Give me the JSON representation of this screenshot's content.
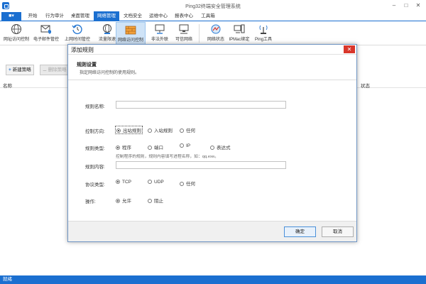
{
  "window": {
    "title": "Ping32终端安全管理系统"
  },
  "menubar": {
    "tabs": [
      {
        "label": "开始",
        "active": false
      },
      {
        "label": "行为审计",
        "active": false
      },
      {
        "label": "桌面管理",
        "active": false
      },
      {
        "label": "网络管理",
        "active": true
      },
      {
        "label": "文档安全",
        "active": false
      },
      {
        "label": "运维中心",
        "active": false
      },
      {
        "label": "报表中心",
        "active": false
      },
      {
        "label": "工具箱",
        "active": false
      }
    ]
  },
  "ribbon": {
    "items": [
      {
        "label": "网址访问控制",
        "icon": "globe-icon"
      },
      {
        "label": "电子邮件管控",
        "icon": "mail-shield-icon"
      },
      {
        "label": "上网时间管控",
        "icon": "clock-refresh-icon"
      },
      {
        "label": "流量限速",
        "icon": "globe-speed-icon"
      },
      {
        "label": "网络访问控制",
        "icon": "firewall-icon"
      },
      {
        "label": "非法外联",
        "icon": "monitor-link-icon"
      },
      {
        "label": "可信网络",
        "icon": "monitor-trusted-icon"
      },
      {
        "label": "网络状态",
        "icon": "network-status-icon"
      },
      {
        "label": "IPMac绑定",
        "icon": "computer-bind-icon"
      },
      {
        "label": "Ping工具",
        "icon": "antenna-icon"
      }
    ]
  },
  "toolbar": {
    "new_label": "新建策略",
    "delete_label": "删除策略"
  },
  "list": {
    "col_name": "名称",
    "col_status": "状态"
  },
  "statusbar": {
    "text": "就绪"
  },
  "dialog": {
    "title": "添加规则",
    "header_title": "规则设置",
    "header_desc": "指定网络访问控制的使用规则。",
    "rule_name_label": "规则名称:",
    "rule_name_value": "",
    "direction": {
      "label": "控制方向:",
      "options": [
        "出站规则",
        "入站规则",
        "任何"
      ],
      "selected": "出站规则"
    },
    "type": {
      "label": "规则类型:",
      "options": [
        "程序",
        "端口",
        "IP",
        "表达式"
      ],
      "selected": "程序"
    },
    "hint": "控制程序的规则，规则内容填写进程名称，如：qq.exe。",
    "content_label": "规则内容:",
    "content_value": "",
    "protocol": {
      "label": "协议类型:",
      "options": [
        "TCP",
        "UDP",
        "任何"
      ],
      "selected": "TCP"
    },
    "action": {
      "label": "操作:",
      "options": [
        "允许",
        "阻止"
      ],
      "selected": "允许"
    },
    "ok_label": "确定",
    "cancel_label": "取消"
  }
}
